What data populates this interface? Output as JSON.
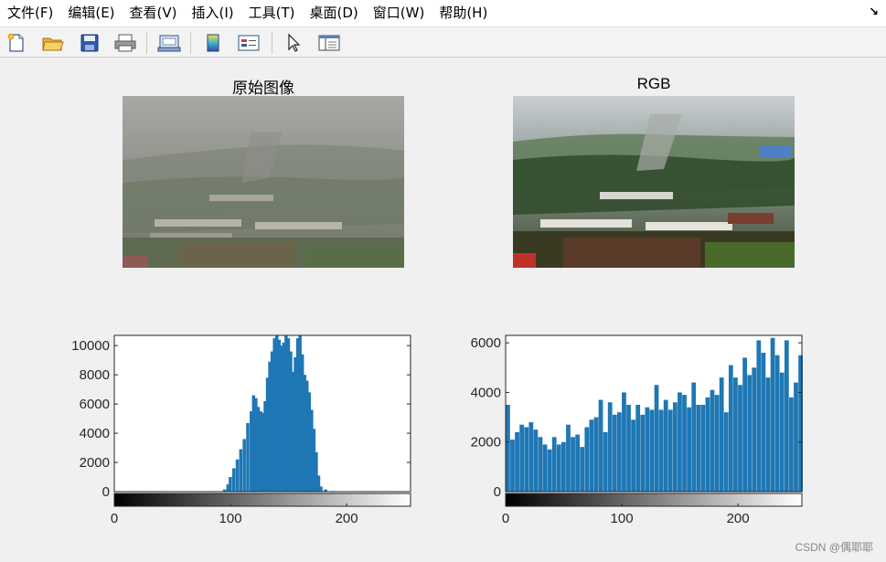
{
  "menu": {
    "items": [
      "文件(F)",
      "编辑(E)",
      "查看(V)",
      "插入(I)",
      "工具(T)",
      "桌面(D)",
      "窗口(W)",
      "帮助(H)"
    ],
    "dock_glyph": "↘"
  },
  "toolbar": {
    "icons": [
      "new-figure-icon",
      "open-file-icon",
      "save-icon",
      "print-icon",
      "print-preview-icon",
      "colorbar-icon",
      "legend-icon",
      "pointer-icon",
      "property-inspector-icon"
    ]
  },
  "subplots": {
    "original_title": "原始图像",
    "rgb_title": "RGB"
  },
  "chart_data": [
    {
      "type": "bar",
      "title": "",
      "xlabel": "",
      "ylabel": "",
      "xlim": [
        0,
        255
      ],
      "ylim": [
        0,
        10700
      ],
      "xticks": [
        0,
        100,
        200
      ],
      "yticks": [
        0,
        2000,
        4000,
        6000,
        8000,
        10000
      ],
      "bar_color": "#1f77b4",
      "colorbar": "grayscale 0-255",
      "x": [
        95,
        98,
        100,
        103,
        106,
        109,
        112,
        115,
        118,
        120,
        122,
        124,
        126,
        128,
        130,
        132,
        134,
        136,
        138,
        140,
        142,
        144,
        146,
        148,
        150,
        152,
        154,
        156,
        158,
        160,
        162,
        164,
        166,
        168,
        170,
        172,
        174,
        176,
        178,
        182,
        188
      ],
      "values": [
        150,
        500,
        1000,
        1600,
        2200,
        2900,
        3600,
        4700,
        5500,
        6600,
        6400,
        5800,
        5500,
        5400,
        6200,
        7800,
        8900,
        9600,
        10500,
        10700,
        10400,
        10000,
        10200,
        10700,
        10500,
        9600,
        8200,
        9200,
        10500,
        10700,
        9400,
        8000,
        7600,
        6800,
        5600,
        4300,
        2700,
        1100,
        350,
        150,
        40
      ]
    },
    {
      "type": "bar",
      "title": "",
      "xlabel": "",
      "ylabel": "",
      "xlim": [
        0,
        255
      ],
      "ylim": [
        0,
        6300
      ],
      "xticks": [
        0,
        100,
        200
      ],
      "yticks": [
        0,
        2000,
        4000,
        6000
      ],
      "bar_color": "#1f77b4",
      "colorbar": "grayscale 0-255",
      "x": [
        2,
        6,
        10,
        14,
        18,
        22,
        26,
        30,
        34,
        38,
        42,
        46,
        50,
        54,
        58,
        62,
        66,
        70,
        74,
        78,
        82,
        86,
        90,
        94,
        98,
        102,
        106,
        110,
        114,
        118,
        122,
        126,
        130,
        134,
        138,
        142,
        146,
        150,
        154,
        158,
        162,
        166,
        170,
        174,
        178,
        182,
        186,
        190,
        194,
        198,
        202,
        206,
        210,
        214,
        218,
        222,
        226,
        230,
        234,
        238,
        242,
        246,
        250,
        254
      ],
      "values": [
        3500,
        2100,
        2400,
        2700,
        2600,
        2800,
        2500,
        2200,
        1900,
        1700,
        2200,
        1900,
        2000,
        2700,
        2200,
        2300,
        1800,
        2600,
        2900,
        3000,
        3700,
        2400,
        3600,
        3100,
        3200,
        4000,
        3500,
        2900,
        3500,
        3100,
        3400,
        3300,
        4300,
        3300,
        3700,
        3300,
        3600,
        4000,
        3900,
        3400,
        4400,
        3500,
        3500,
        3800,
        4100,
        3900,
        4600,
        3200,
        5100,
        4600,
        4300,
        5400,
        4700,
        5000,
        6100,
        5600,
        4600,
        6200,
        5500,
        4800,
        6100,
        3800,
        4400,
        5500
      ]
    }
  ]
}
